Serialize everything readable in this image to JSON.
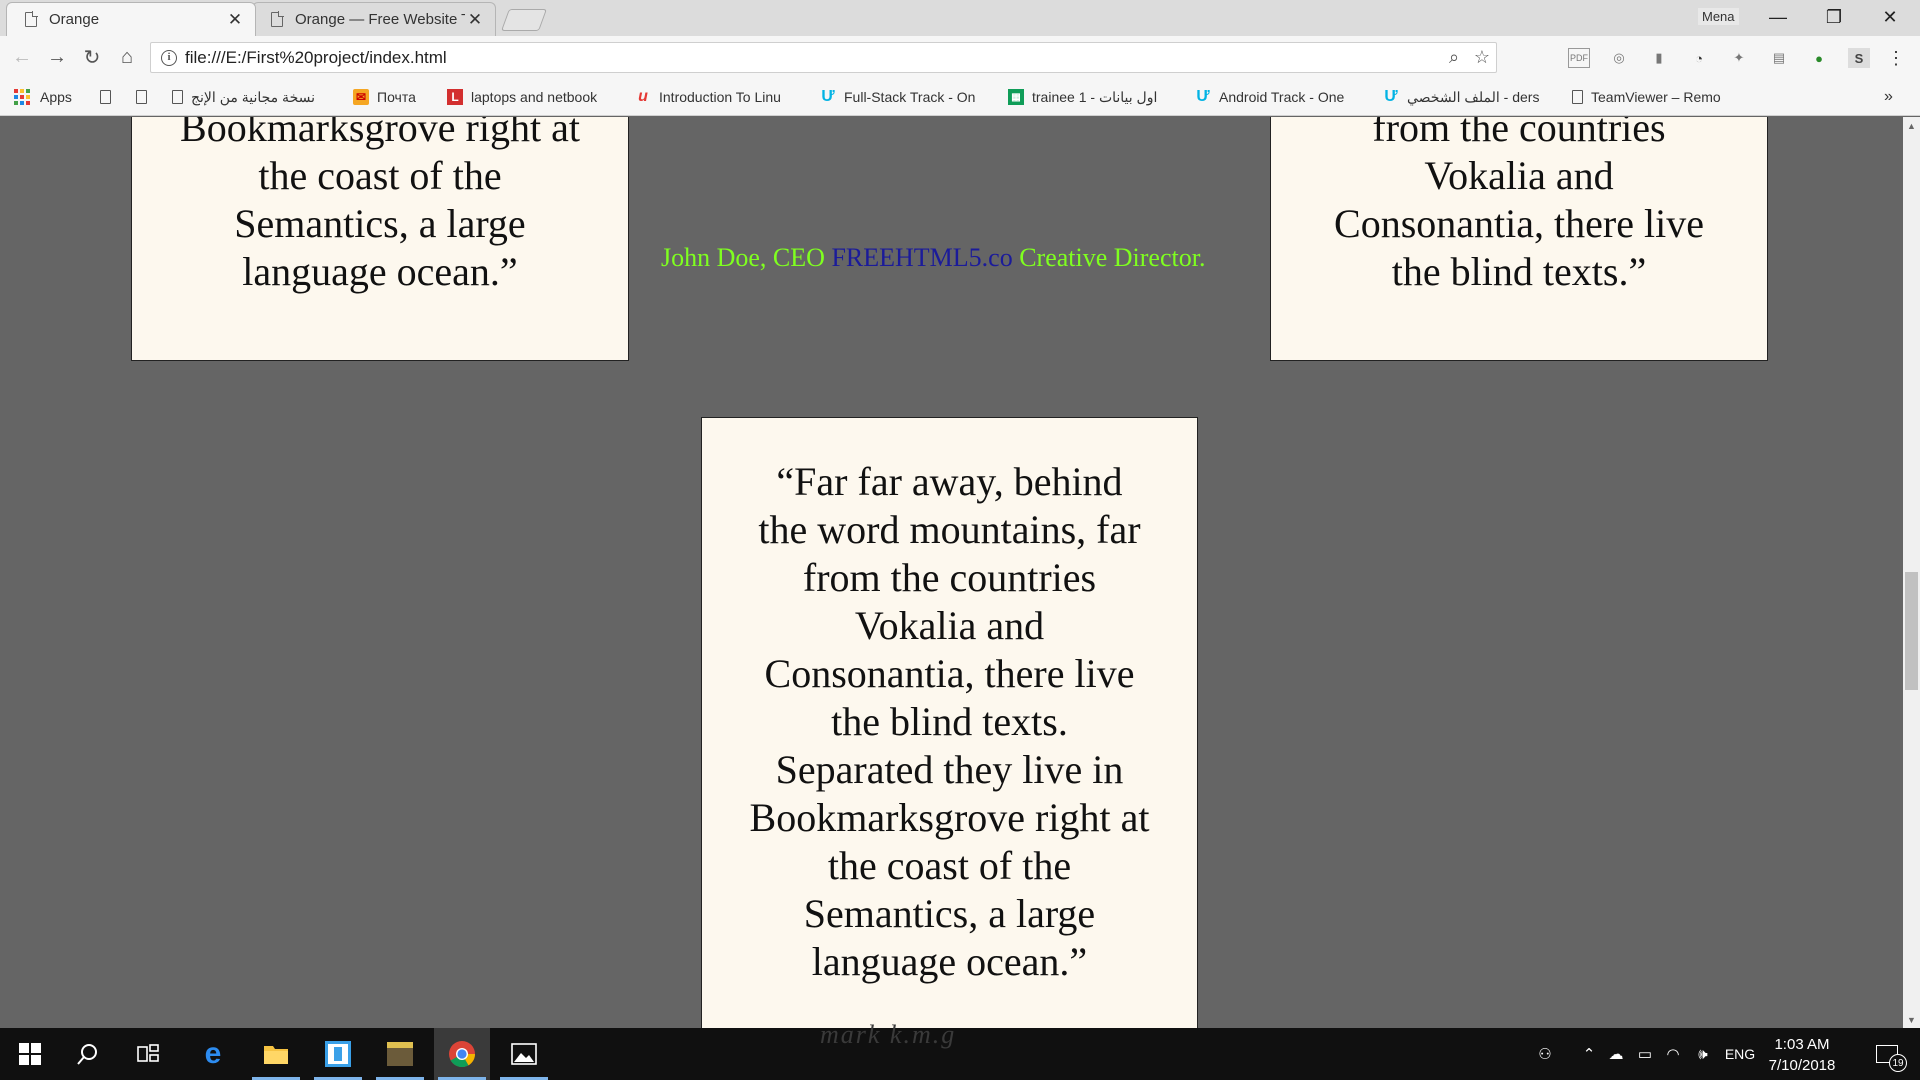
{
  "browser": {
    "tabs": [
      {
        "title": "Orange",
        "active": true
      },
      {
        "title": "Orange — Free Website T",
        "active": false
      }
    ],
    "profile_name": "Mena",
    "window_controls": {
      "minimize": "—",
      "restore": "❐",
      "close": "✕"
    },
    "address": "file:///E:/First%20project/index.html",
    "bookmarks": [
      {
        "label": "Apps",
        "icon": "apps-grid-icon"
      },
      {
        "label": "",
        "icon": "document-icon"
      },
      {
        "label": "",
        "icon": "document-icon"
      },
      {
        "label": "نسخة مجانية من الإنج",
        "icon": "document-icon"
      },
      {
        "label": "Почта",
        "icon": "mail-icon"
      },
      {
        "label": "laptops and netbook",
        "icon": "l-logo-icon"
      },
      {
        "label": "Introduction To Linu",
        "icon": "udemy-icon"
      },
      {
        "label": "Full-Stack Track - On",
        "icon": "udacity-icon"
      },
      {
        "label": "trainee 1 - اول بيانات",
        "icon": "sheets-icon"
      },
      {
        "label": "Android Track - One",
        "icon": "udacity-icon"
      },
      {
        "label": "الملف الشخصي - ders",
        "icon": "udacity-icon"
      },
      {
        "label": "TeamViewer – Remo",
        "icon": "document-icon"
      }
    ],
    "bookmarks_overflow": "»"
  },
  "page": {
    "card_top_left_lines": [
      "Bookmarksgrove right at",
      "the coast of the",
      "Semantics, a large",
      "language ocean.”"
    ],
    "card_top_right_lines": [
      "from the countries",
      "Vokalia and",
      "Consonantia, there live",
      "the blind texts.”"
    ],
    "author": {
      "prefix": "John Doe, CEO ",
      "brand": "FREEHTML5.co",
      "suffix": " Creative Director."
    },
    "card_center_lines": [
      "“Far far away, behind",
      "the word mountains, far",
      "from the countries",
      "Vokalia and",
      "Consonantia, there live",
      "the blind texts.",
      "Separated they live in",
      "Bookmarksgrove right at",
      "the coast of the",
      "Semantics, a large",
      "language ocean.”"
    ],
    "watermark": "mark k.m.g"
  },
  "taskbar": {
    "lang": "ENG",
    "time": "1:03 AM",
    "date": "7/10/2018",
    "notifications": "19"
  },
  "colors": {
    "page_bg": "#656565",
    "card_bg": "#fdf8ee",
    "author_green": "#7fff1f",
    "brand_blue": "#1b1b9a"
  }
}
